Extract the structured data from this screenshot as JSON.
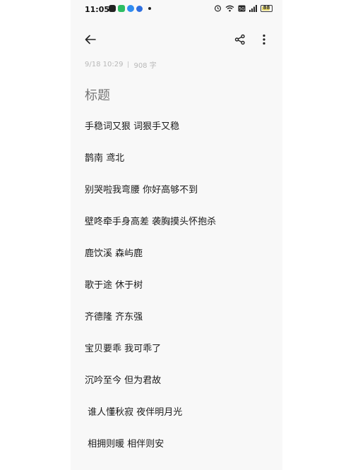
{
  "status_bar": {
    "time": "11:05",
    "battery_level": "88",
    "battery_fraction": 0.88,
    "icons": [
      "app-icon-1",
      "app-icon-2",
      "app-icon-3",
      "app-icon-4",
      "alarm-icon",
      "wifi-icon",
      "sim-icon",
      "signal-icon",
      "battery-icon"
    ]
  },
  "toolbar": {
    "back_icon": "back-arrow-icon",
    "share_icon": "share-icon",
    "more_icon": "more-vertical-icon"
  },
  "note": {
    "date": "9/18 10:29",
    "word_count": "908 字",
    "title_placeholder": "标题",
    "lines": [
      "手稳词又狠 词狠手又稳",
      "鹊南 鸢北",
      "别哭啦我弯腰 你好高够不到",
      "壁咚牵手身高差 袭胸摸头怀抱杀",
      "鹿饮溪 森屿鹿",
      "歌于途 休于树",
      "齐德隆 齐东强",
      "宝贝要乖 我可乖了",
      "沉吟至今 但为君故",
      " 谁人懂秋寂 夜伴明月光",
      " 相拥则暖 相伴则安"
    ]
  },
  "colors": {
    "background": "#f8f8f8",
    "text": "#1a1a1a",
    "meta_text": "#b8b8b8",
    "placeholder": "#d6d6d6",
    "battery": "#e9d96b"
  }
}
